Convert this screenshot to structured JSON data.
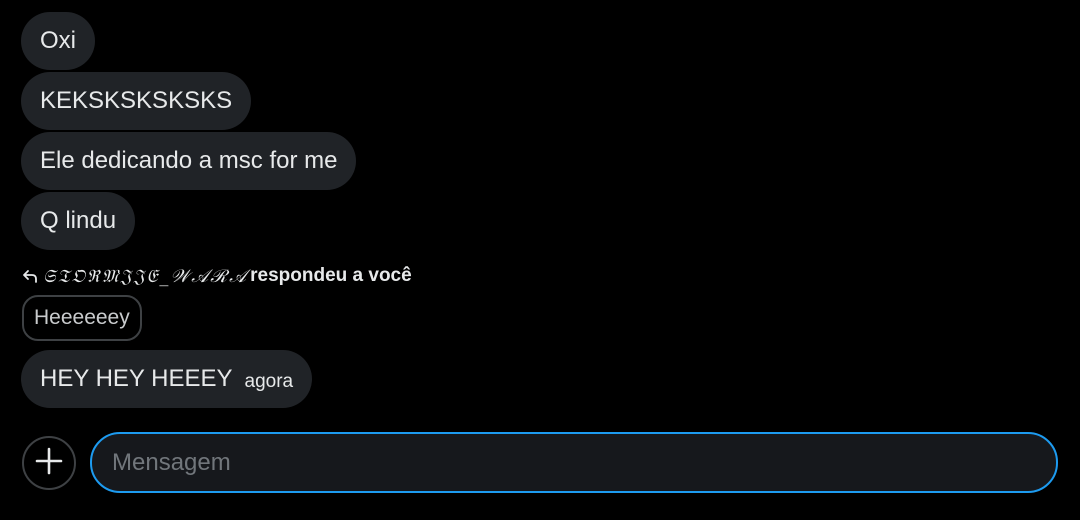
{
  "messages": [
    {
      "text": "Oxi"
    },
    {
      "text": "KEKSKSKSKSKS"
    },
    {
      "text": "Ele dedicando a msc for me"
    },
    {
      "text": "Q lindu"
    }
  ],
  "reply": {
    "name": "𝔖𝔗𝔒ℜ𝔐𝔍𝔍𝔈_𝒲𝒜ℛ𝒜",
    "action": "respondeu a você",
    "quoted_text": "Heeeeeey"
  },
  "last_message": {
    "text": "HEY HEY HEEEY",
    "timestamp": "agora"
  },
  "composer": {
    "placeholder": "Mensagem",
    "value": ""
  },
  "colors": {
    "background": "#000000",
    "bubble": "#202327",
    "accent_border": "#1d9bf0",
    "text": "#e7e9ea",
    "placeholder": "#71767b"
  },
  "icons": {
    "add": "plus-icon",
    "reply": "reply-arrow-icon"
  }
}
